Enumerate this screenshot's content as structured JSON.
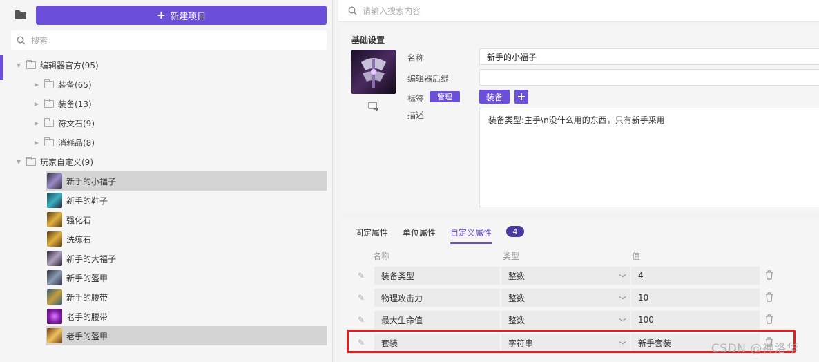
{
  "left": {
    "new_button_label": "新建项目",
    "search_placeholder": "搜索",
    "groups": [
      {
        "label": "编辑器官方(95)"
      },
      {
        "label": "装备(65)"
      },
      {
        "label": "装备(13)"
      },
      {
        "label": "符文石(9)"
      },
      {
        "label": "消耗品(8)"
      },
      {
        "label": "玩家自定义(9)"
      }
    ],
    "items": [
      {
        "label": "新手的小福子",
        "color": "#7a6aa8"
      },
      {
        "label": "新手的鞋子",
        "color": "#2a8a9a"
      },
      {
        "label": "强化石",
        "color": "#c8a030"
      },
      {
        "label": "洗练石",
        "color": "#c8a030"
      },
      {
        "label": "新手的大福子",
        "color": "#6a5a7a"
      },
      {
        "label": "新手的盔甲",
        "color": "#5a6a7a"
      },
      {
        "label": "新手的腰带",
        "color": "#8a7a30"
      },
      {
        "label": "老手的腰带",
        "color": "#9a40b0"
      },
      {
        "label": "老手的盔甲",
        "color": "#b07a30"
      }
    ]
  },
  "top_search_placeholder": "请输入搜索内容",
  "basic": {
    "title": "基础设置",
    "name_label": "名称",
    "name_value": "新手的小福子",
    "suffix_label": "编辑器后缀",
    "suffix_value": "",
    "tags_label": "标签",
    "manage_label": "管理",
    "tag_value": "装备",
    "add_symbol": "+",
    "desc_label": "描述",
    "desc_value": "装备类型:主手\\n没什么用的东西，只有新手采用"
  },
  "props": {
    "tabs": [
      "固定属性",
      "单位属性",
      "自定义属性"
    ],
    "active_tab": "自定义属性",
    "count": "4",
    "headers": {
      "name": "名称",
      "type": "类型",
      "value": "值"
    },
    "rows": [
      {
        "name": "装备类型",
        "type": "整数",
        "value": "4"
      },
      {
        "name": "物理攻击力",
        "type": "整数",
        "value": "10"
      },
      {
        "name": "最大生命值",
        "type": "整数",
        "value": "100"
      },
      {
        "name": "套装",
        "type": "字符串",
        "value": "新手套装"
      }
    ]
  },
  "watermark": "CSDN @神洛华",
  "colors": {
    "accent": "#6b4fd8",
    "highlight": "#e02020"
  }
}
